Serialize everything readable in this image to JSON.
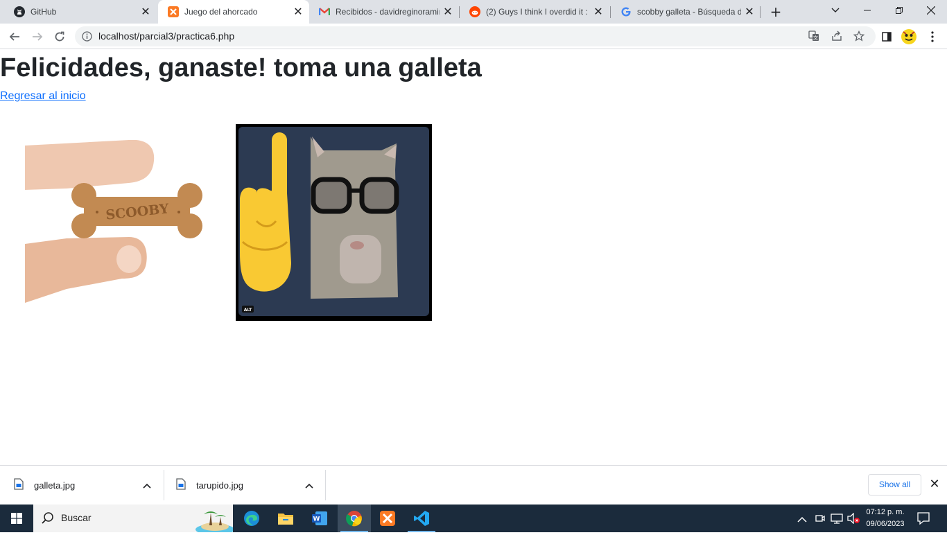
{
  "browser": {
    "tabs": [
      {
        "title": "GitHub",
        "icon": "github-icon"
      },
      {
        "title": "Juego del ahorcado",
        "icon": "xampp-icon"
      },
      {
        "title": "Recibidos - davidreginoramir",
        "icon": "gmail-icon"
      },
      {
        "title": "(2) Guys I think I overdid it : g",
        "icon": "reddit-icon"
      },
      {
        "title": "scobby galleta - Búsqueda de",
        "icon": "google-icon"
      }
    ],
    "new_tab_label": "+",
    "url": "localhost/parcial3/practica6.php"
  },
  "page": {
    "heading": "Felicidades, ganaste! toma una galleta",
    "back_link": "Regresar al inicio",
    "cookie_text": "SCOOBY",
    "alt_badge": "ALT"
  },
  "downloads": {
    "items": [
      {
        "filename": "galleta.jpg"
      },
      {
        "filename": "tarupido.jpg"
      }
    ],
    "show_all": "Show all"
  },
  "taskbar": {
    "search_placeholder": "Buscar",
    "time": "07:12 p. m.",
    "date": "09/06/2023"
  },
  "colors": {
    "link": "#0d6efd",
    "tabstrip": "#dee1e6",
    "taskbar": "#1b2b3c"
  }
}
